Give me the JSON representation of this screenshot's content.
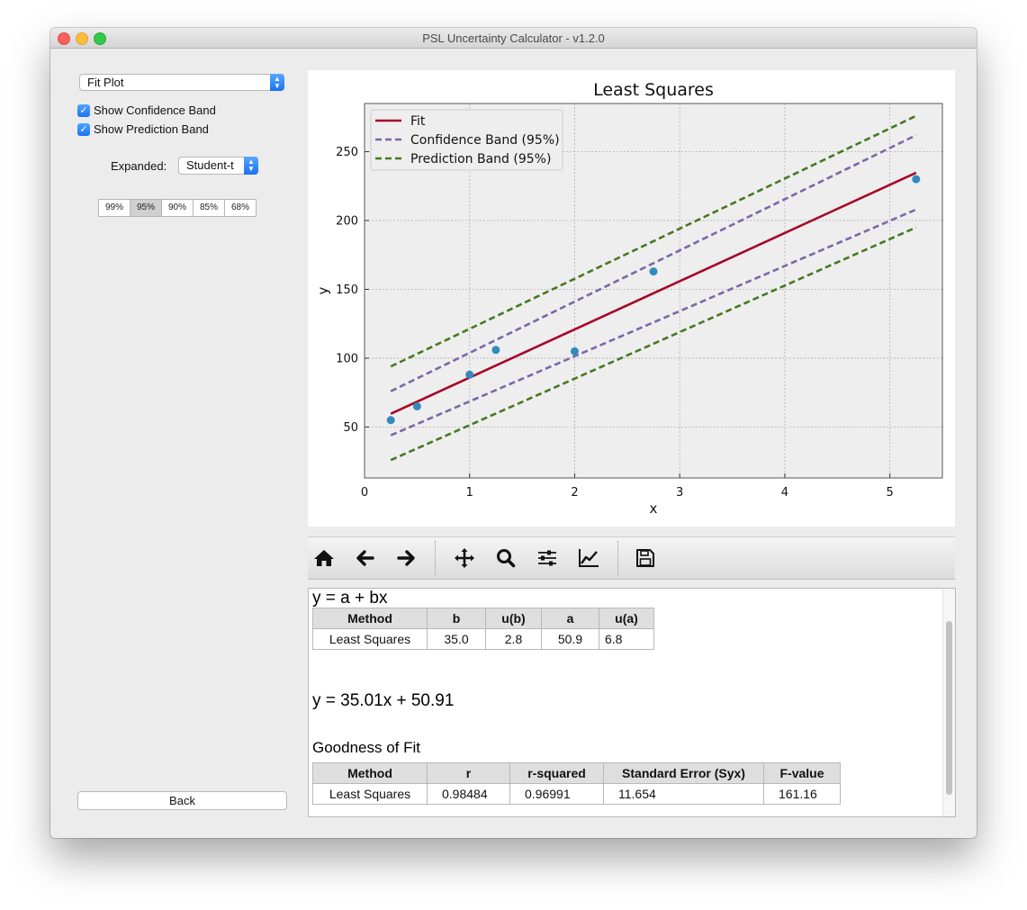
{
  "window": {
    "title": "PSL Uncertainty Calculator - v1.2.0"
  },
  "sidebar": {
    "plot_select_value": "Fit Plot",
    "show_confidence_label": "Show Confidence Band",
    "show_prediction_label": "Show Prediction Band",
    "expanded_label": "Expanded:",
    "expanded_select_value": "Student-t",
    "percent_buttons": [
      "99%",
      "95%",
      "90%",
      "85%",
      "68%"
    ],
    "selected_percent": "95%",
    "back_label": "Back"
  },
  "chart_data": {
    "type": "scatter",
    "title": "Least Squares",
    "xlabel": "x",
    "ylabel": "y",
    "xlim": [
      0,
      5.5
    ],
    "ylim": [
      13,
      285
    ],
    "xticks": [
      0,
      1,
      2,
      3,
      4,
      5
    ],
    "yticks": [
      50,
      100,
      150,
      200,
      250
    ],
    "grid": true,
    "legend_position": "top-left",
    "points": {
      "x": [
        0.25,
        0.5,
        1.0,
        1.25,
        2.0,
        2.75,
        5.25
      ],
      "y": [
        55,
        65,
        88,
        106,
        105,
        163,
        230
      ]
    },
    "fit": {
      "name": "Fit",
      "a": 50.91,
      "b": 35.01,
      "x_range": [
        0.25,
        5.25
      ],
      "color": "#a60628"
    },
    "confidence_band": {
      "name": "Confidence Band (95%)",
      "color": "#7a68a6",
      "x": [
        0.25,
        2.75,
        5.25
      ],
      "lower": [
        44,
        136,
        208
      ],
      "upper": [
        76,
        160,
        262
      ]
    },
    "prediction_band": {
      "name": "Prediction Band (95%)",
      "color": "#467821",
      "x": [
        0.25,
        2.75,
        5.25
      ],
      "lower": [
        26,
        111,
        195
      ],
      "upper": [
        94,
        185,
        276
      ]
    },
    "point_color": "#348abd"
  },
  "toolbar": {
    "buttons": [
      "home-icon",
      "back-arrow-icon",
      "forward-arrow-icon",
      "pan-icon",
      "zoom-icon",
      "configure-subplots-icon",
      "edit-axis-icon",
      "save-icon"
    ]
  },
  "results": {
    "model_equation": "y = a + bx",
    "params_table": {
      "headers": [
        "Method",
        "b",
        "u(b)",
        "a",
        "u(a)"
      ],
      "rows": [
        [
          "Least Squares",
          "35.0",
          "2.8",
          "50.9",
          "6.8"
        ]
      ]
    },
    "fit_equation": "y = 35.01x + 50.91",
    "goodness_heading": "Goodness of Fit",
    "gof_table": {
      "headers": [
        "Method",
        "r",
        "r-squared",
        "Standard Error (Syx)",
        "F-value"
      ],
      "rows": [
        [
          "Least Squares",
          "0.98484",
          "0.96991",
          "11.654",
          "161.16"
        ]
      ]
    }
  }
}
